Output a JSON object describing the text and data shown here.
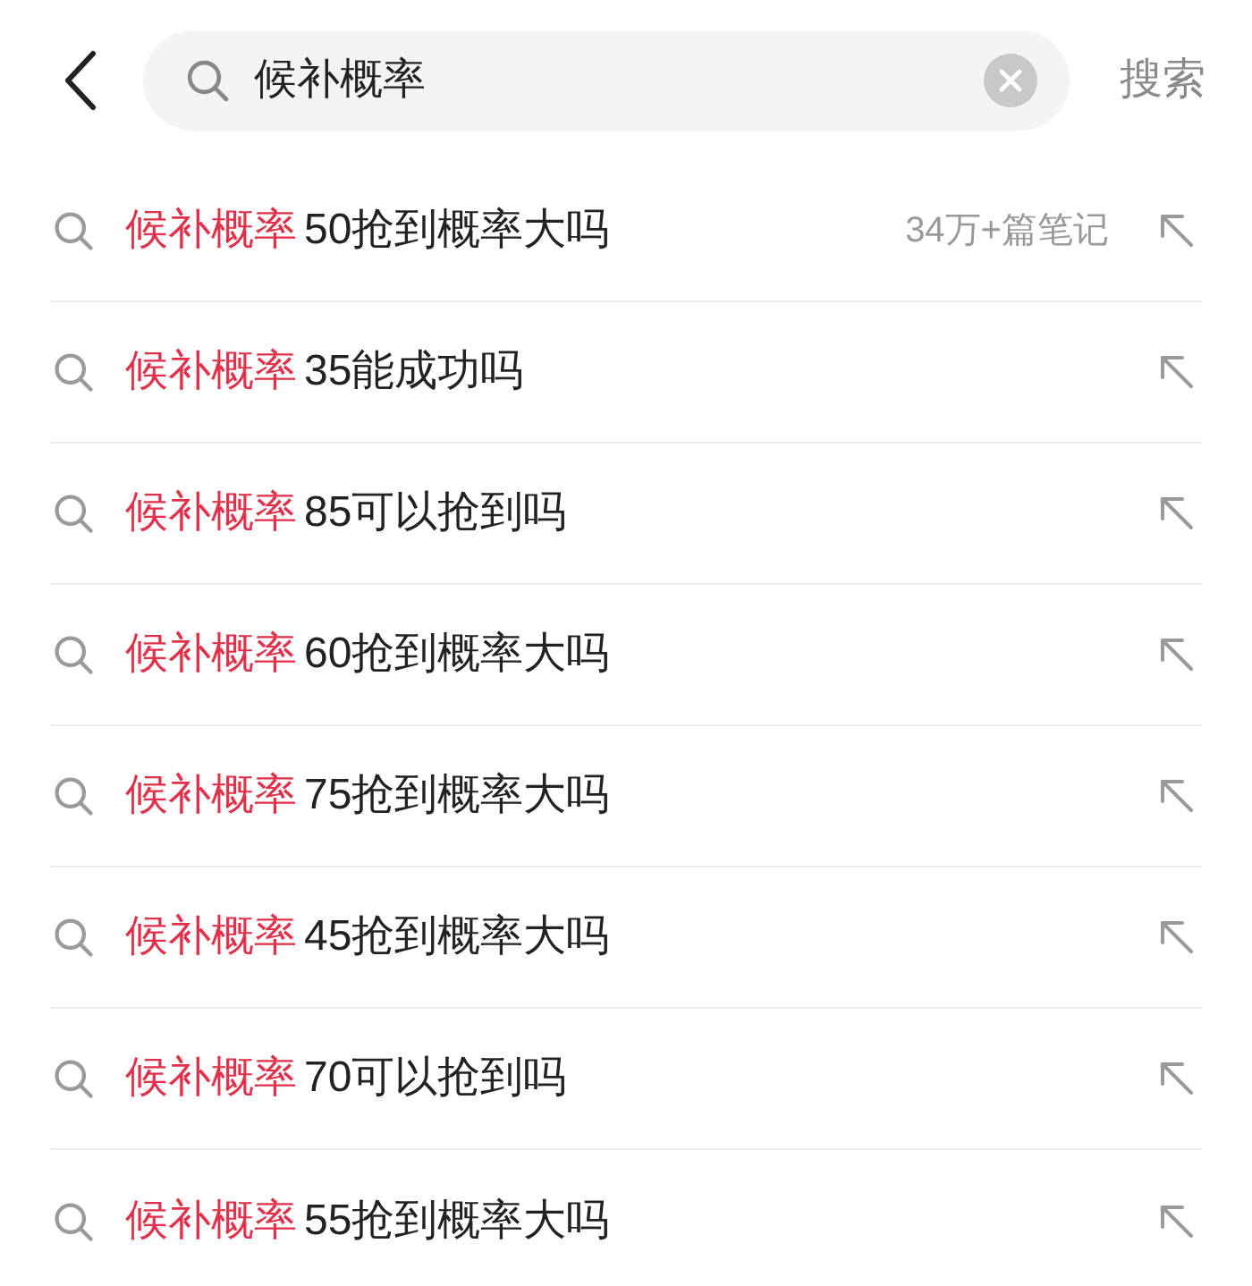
{
  "search": {
    "value": "候补概率",
    "action": "搜索"
  },
  "suggestions": [
    {
      "match": "候补概率",
      "rest": "50抢到概率大吗",
      "note": "34万+篇笔记"
    },
    {
      "match": "候补概率",
      "rest": "35能成功吗"
    },
    {
      "match": "候补概率",
      "rest": "85可以抢到吗"
    },
    {
      "match": "候补概率",
      "rest": "60抢到概率大吗"
    },
    {
      "match": "候补概率",
      "rest": "75抢到概率大吗"
    },
    {
      "match": "候补概率",
      "rest": "45抢到概率大吗"
    },
    {
      "match": "候补概率",
      "rest": "70可以抢到吗"
    },
    {
      "match": "候补概率",
      "rest": "55抢到概率大吗"
    }
  ]
}
